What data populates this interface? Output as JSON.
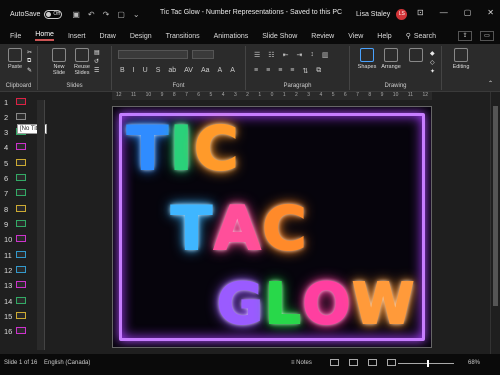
{
  "titlebar": {
    "autosave_label": "AutoSave",
    "autosave_state": "Off",
    "doc_title": "Tic Tac Glow - Number Representations",
    "save_status": "Saved to this PC",
    "user_name": "Lisa Staley",
    "user_initials": "LS"
  },
  "menu": {
    "tabs": [
      "File",
      "Home",
      "Insert",
      "Draw",
      "Design",
      "Transitions",
      "Animations",
      "Slide Show",
      "Review",
      "View",
      "Help"
    ],
    "active_tab": "Home",
    "search_label": "Search"
  },
  "ribbon": {
    "paste": "Paste",
    "new_slide": "New Slide",
    "reuse_slides": "Reuse Slides",
    "shapes": "Shapes",
    "arrange": "Arrange",
    "editing": "Editing",
    "groups": [
      "Clipboard",
      "Slides",
      "Font",
      "Paragraph",
      "Drawing"
    ],
    "format_buttons": [
      "B",
      "I",
      "U",
      "S",
      "ab",
      "AV",
      "Aa",
      "A",
      "A"
    ]
  },
  "thumbnails": {
    "numbers": [
      "1",
      "2",
      "3",
      "4",
      "5",
      "6",
      "7",
      "8",
      "9",
      "10",
      "11",
      "12",
      "13",
      "14",
      "15",
      "16"
    ],
    "tooltip": "[No Title]"
  },
  "ruler": {
    "ticks": [
      "12",
      "11",
      "10",
      "9",
      "8",
      "7",
      "6",
      "5",
      "4",
      "3",
      "2",
      "1",
      "0",
      "1",
      "2",
      "3",
      "4",
      "5",
      "6",
      "7",
      "8",
      "9",
      "10",
      "11",
      "12"
    ]
  },
  "slide": {
    "line1": "TIC",
    "line2": "TAC",
    "line3": "GLOW",
    "colors": {
      "T1": "#2f8cff",
      "I1": "#2ad17a",
      "C1": "#ff9a2a",
      "T2": "#3fb6ff",
      "A2": "#ff4f9a",
      "C2": "#ff8a2a",
      "G3": "#9a5bff",
      "L3": "#28d84a",
      "O3": "#ff3fa0",
      "W3": "#ff9a3a"
    }
  },
  "status": {
    "slide_info": "Slide 1 of 16",
    "language": "English (Canada)",
    "notes": "Notes",
    "zoom": "68%"
  }
}
